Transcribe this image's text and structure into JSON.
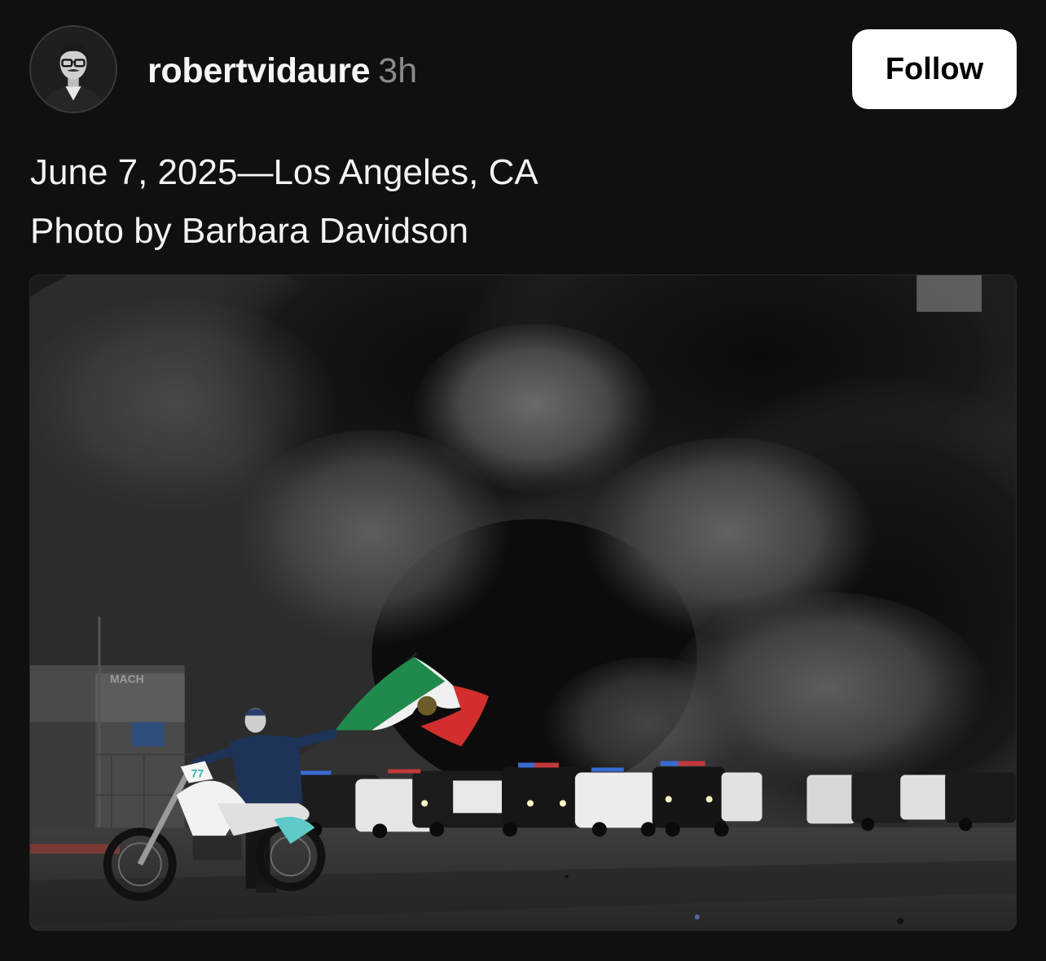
{
  "post": {
    "author": {
      "username": "robertvidaure",
      "timestamp": "3h",
      "avatar_icon": "person-avatar-icon"
    },
    "follow_label": "Follow",
    "caption": [
      "June 7, 2025—Los Angeles, CA",
      "Photo by Barbara Davidson"
    ],
    "photo": {
      "storefront_sign": "MACH",
      "bike_number": "77"
    }
  },
  "colors": {
    "background": "#101010",
    "text": "#f3f3f3",
    "timestamp": "#8a8a8a",
    "button_bg": "#ffffff",
    "button_text": "#000000"
  }
}
